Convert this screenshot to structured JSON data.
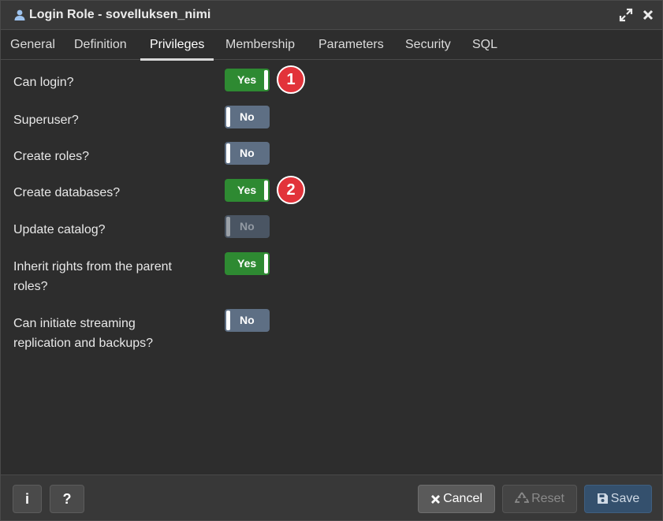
{
  "window": {
    "title": "Login Role - sovelluksen_nimi",
    "icons": {
      "title": "user-role-icon",
      "maximize": "expand-icon",
      "close": "close-icon"
    }
  },
  "tabs": [
    {
      "label": "General",
      "active": false
    },
    {
      "label": "Definition",
      "active": false
    },
    {
      "label": "Privileges",
      "active": true
    },
    {
      "label": "Membership",
      "active": false
    },
    {
      "label": "Parameters",
      "active": false
    },
    {
      "label": "Security",
      "active": false
    },
    {
      "label": "SQL",
      "active": false
    }
  ],
  "privileges": [
    {
      "label": "Can login?",
      "value": "Yes",
      "state": "on",
      "annotation": "1"
    },
    {
      "label": "Superuser?",
      "value": "No",
      "state": "off"
    },
    {
      "label": "Create roles?",
      "value": "No",
      "state": "off"
    },
    {
      "label": "Create databases?",
      "value": "Yes",
      "state": "on",
      "annotation": "2"
    },
    {
      "label": "Update catalog?",
      "value": "No",
      "state": "disabled"
    },
    {
      "label": "Inherit rights from the parent roles?",
      "value": "Yes",
      "state": "on"
    },
    {
      "label": "Can initiate streaming replication and backups?",
      "value": "No",
      "state": "off"
    }
  ],
  "footer": {
    "info_label": "i",
    "help_label": "?",
    "cancel_label": "Cancel",
    "reset_label": "Reset",
    "save_label": "Save"
  },
  "colors": {
    "toggle_on": "#2e8a32",
    "toggle_off": "#5e6f84",
    "annotation": "#e2333a",
    "save": "#34506d"
  }
}
